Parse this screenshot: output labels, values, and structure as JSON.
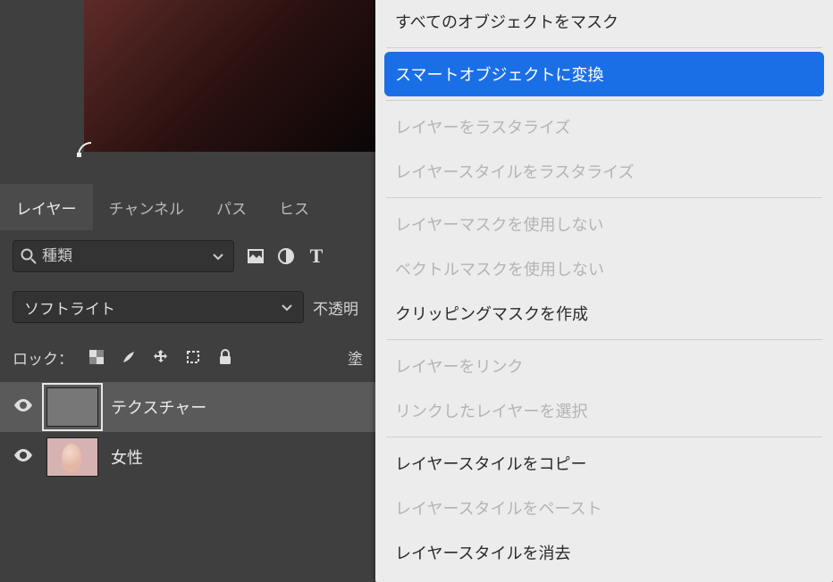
{
  "panels": {
    "tabs": [
      "レイヤー",
      "チャンネル",
      "パス",
      "ヒス"
    ],
    "active_tab": 0
  },
  "filter": {
    "placeholder": "種類"
  },
  "blend": {
    "mode": "ソフトライト",
    "opacity_label": "不透明"
  },
  "lock": {
    "label": "ロック：",
    "fill_label": "塗"
  },
  "layers": [
    {
      "name": "テクスチャー",
      "selected": true,
      "kind": "gray"
    },
    {
      "name": "女性",
      "selected": false,
      "kind": "photo"
    }
  ],
  "context_menu": [
    {
      "type": "sep-top"
    },
    {
      "label": "すべてのオブジェクトをマスク",
      "state": "normal"
    },
    {
      "type": "sep"
    },
    {
      "label": "スマートオブジェクトに変換",
      "state": "highlight"
    },
    {
      "type": "sep"
    },
    {
      "label": "レイヤーをラスタライズ",
      "state": "disabled"
    },
    {
      "label": "レイヤースタイルをラスタライズ",
      "state": "disabled"
    },
    {
      "type": "sep"
    },
    {
      "label": "レイヤーマスクを使用しない",
      "state": "disabled"
    },
    {
      "label": "ベクトルマスクを使用しない",
      "state": "disabled"
    },
    {
      "label": "クリッピングマスクを作成",
      "state": "normal"
    },
    {
      "type": "sep"
    },
    {
      "label": "レイヤーをリンク",
      "state": "disabled"
    },
    {
      "label": "リンクしたレイヤーを選択",
      "state": "disabled"
    },
    {
      "type": "sep"
    },
    {
      "label": "レイヤースタイルをコピー",
      "state": "normal"
    },
    {
      "label": "レイヤースタイルをペースト",
      "state": "disabled"
    },
    {
      "label": "レイヤースタイルを消去",
      "state": "normal"
    }
  ]
}
